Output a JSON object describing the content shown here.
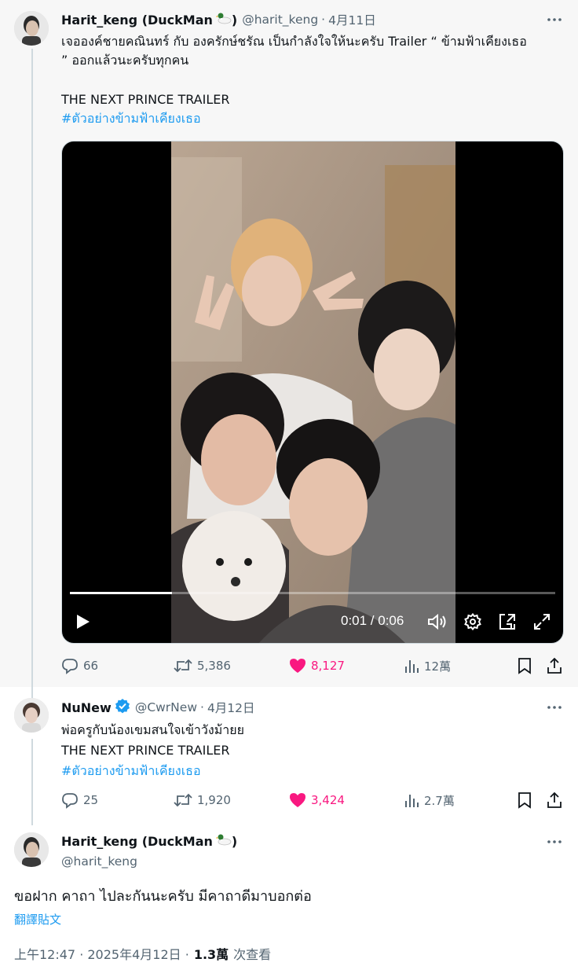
{
  "tweet1": {
    "name": "Harit_keng (DuckMan",
    "name_suffix": ")",
    "handle": "@harit_keng",
    "dot": "·",
    "date": "4月11日",
    "line1": "เจอองค์ชายคณินทร์ กับ องครักษ์ชรัณ เป็นกำลังใจให้นะครับ Trailer “ ข้ามฟ้าเคียงเธอ",
    "line2": "” ออกแล้วนะครับทุกคน",
    "line3": "THE NEXT PRINCE TRAILER",
    "hashtag": "#ตัวอย่างข้ามฟ้าเคียงเธอ",
    "video": {
      "time": "0:01 / 0:06",
      "progress": 0.21
    },
    "replies": "66",
    "reposts": "5,386",
    "likes": "8,127",
    "views": "12萬"
  },
  "tweet2": {
    "name": "NuNew",
    "handle": "@CwrNew",
    "dot": "·",
    "date": "4月12日",
    "line1": "พ่อครูกับน้องเขมสนใจเข้าวังม้ายย",
    "line2": "THE NEXT PRINCE TRAILER",
    "hashtag": "#ตัวอย่างข้ามฟ้าเคียงเธอ",
    "replies": "25",
    "reposts": "1,920",
    "likes": "3,424",
    "views": "2.7萬"
  },
  "tweet3": {
    "name": "Harit_keng (DuckMan",
    "name_suffix": ")",
    "handle": "@harit_keng",
    "text": "ขอฝาก คาถา ไปละกันนะครับ มีคาถาดีมาบอกต่อ",
    "translate": "翻譯貼文",
    "time": "上午12:47 · 2025年4月12日 ·",
    "views": "1.3萬",
    "views_label": "次查看"
  },
  "colors": {
    "accent": "#1d9bf0",
    "like": "#f91880",
    "muted": "#536471"
  },
  "icons": [
    "more-icon",
    "reply-icon",
    "repost-icon",
    "like-icon",
    "views-icon",
    "bookmark-icon",
    "share-icon",
    "play-icon",
    "volume-icon",
    "settings-icon",
    "pip-icon",
    "fullscreen-icon",
    "verified-icon",
    "duck-emoji-icon"
  ]
}
